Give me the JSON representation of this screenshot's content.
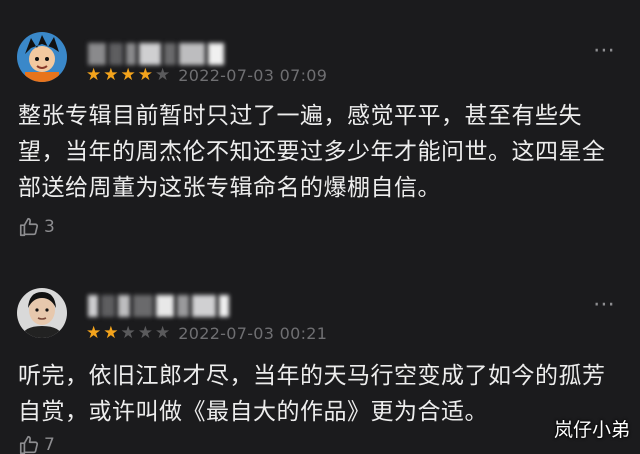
{
  "comments": [
    {
      "rating": 4,
      "rating_max": 5,
      "timestamp": "2022-07-03 07:09",
      "more_icon": "more-icon",
      "text": "整张专辑目前暂时只过了一遍，感觉平平，甚至有些失望，当年的周杰伦不知还要过多少年才能问世。这四星全部送给周董为这张专辑命名的爆棚自信。",
      "likes": "3"
    },
    {
      "rating": 2,
      "rating_max": 5,
      "timestamp": "2022-07-03 00:21",
      "more_icon": "more-icon",
      "text": "听完，依旧江郎才尽，当年的天马行空变成了如今的孤芳自赏，或许叫做《最自大的作品》更为合适。",
      "likes": "7"
    }
  ],
  "watermark": "岚仔小弟",
  "colors": {
    "background": "#1b1b1d",
    "star_on": "#f4a41c",
    "star_off": "#5a5a5c"
  }
}
